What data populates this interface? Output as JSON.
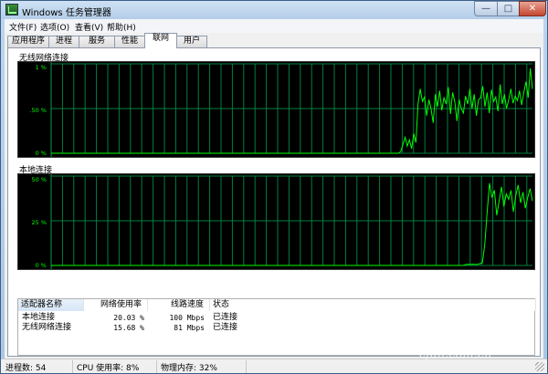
{
  "window": {
    "title": "Windows 任务管理器"
  },
  "controls": {
    "minimize": "—",
    "maximize": "□",
    "close": "✕"
  },
  "menu": [
    {
      "label": "文件(F)"
    },
    {
      "label": "选项(O)"
    },
    {
      "label": "查看(V)"
    },
    {
      "label": "帮助(H)"
    }
  ],
  "tabs": [
    {
      "label": "应用程序",
      "active": false
    },
    {
      "label": "进程",
      "active": false
    },
    {
      "label": "服务",
      "active": false
    },
    {
      "label": "性能",
      "active": false
    },
    {
      "label": "联网",
      "active": true
    },
    {
      "label": "用户",
      "active": false
    }
  ],
  "graphs": [
    {
      "name": "wireless",
      "label": "无线网络连接",
      "ticks": [
        "1 %",
        ".50 %",
        "0 %"
      ],
      "ymax": 1,
      "line_color": "#00ff00",
      "grid_color": "#008040",
      "samples": [
        0,
        0,
        0,
        0,
        0,
        0,
        0,
        0,
        0,
        0,
        0,
        0,
        0,
        0,
        0,
        0,
        0,
        0,
        0,
        0,
        0,
        0,
        0,
        0,
        0,
        0,
        0,
        0,
        0,
        0,
        0,
        0,
        0,
        0,
        0,
        0,
        0,
        0,
        0,
        0,
        0,
        0,
        0,
        0,
        0,
        0,
        0,
        0,
        0,
        0,
        0,
        0,
        0,
        0,
        0,
        0,
        0,
        0,
        0,
        0,
        0,
        0,
        0,
        0,
        0,
        0,
        0,
        0,
        0,
        0,
        0,
        0,
        0,
        0,
        0,
        0,
        0,
        0,
        0,
        0,
        0,
        0,
        0,
        0,
        0,
        0,
        0,
        0,
        0,
        0,
        0,
        0,
        0,
        0,
        0,
        0,
        0,
        0,
        0,
        0,
        0,
        0,
        0,
        0,
        0,
        0,
        0,
        0,
        0,
        0,
        0,
        0,
        0,
        0,
        0,
        0,
        0,
        0,
        0,
        0,
        0,
        0,
        0,
        0,
        0,
        0,
        0,
        0,
        0,
        0,
        0,
        0,
        0,
        0,
        0,
        0,
        0,
        0,
        0,
        0,
        0,
        0,
        0,
        0,
        0,
        0,
        0,
        0,
        0,
        0,
        0,
        0,
        0,
        0,
        0,
        0,
        0,
        0,
        0,
        0,
        0,
        0,
        0.02,
        0.1,
        0.18,
        0.08,
        0.15,
        0.05,
        0.22,
        0.12,
        0.55,
        0.72,
        0.58,
        0.63,
        0.42,
        0.6,
        0.5,
        0.34,
        0.66,
        0.52,
        0.7,
        0.48,
        0.62,
        0.55,
        0.74,
        0.44,
        0.68,
        0.58,
        0.36,
        0.6,
        0.5,
        0.45,
        0.64,
        0.55,
        0.72,
        0.5,
        0.66,
        0.42,
        0.6,
        0.62,
        0.75,
        0.52,
        0.68,
        0.45,
        0.71,
        0.58,
        0.63,
        0.47,
        0.77,
        0.55,
        0.66,
        0.5,
        0.6,
        0.72,
        0.56,
        0.64,
        0.59,
        0.7,
        0.54,
        0.68,
        0.8,
        0.62,
        0.95,
        0.72
      ]
    },
    {
      "name": "local",
      "label": "本地连接",
      "ticks": [
        "50 %",
        "25 %",
        "0 %"
      ],
      "ymax": 50,
      "line_color": "#00ff00",
      "grid_color": "#008040",
      "samples": [
        0,
        0,
        0,
        0,
        0,
        0,
        0,
        0,
        0,
        0,
        0,
        0,
        0,
        0,
        0,
        0,
        0,
        0,
        0,
        0,
        0,
        0,
        0,
        0,
        0,
        0,
        0,
        0,
        0,
        0,
        0,
        0,
        0,
        0,
        0,
        0,
        0,
        0,
        0,
        0,
        0,
        0,
        0,
        0,
        0,
        0,
        0,
        0,
        0,
        0,
        0,
        0,
        0,
        0,
        0,
        0,
        0,
        0,
        0,
        0,
        0,
        0,
        0,
        0,
        0,
        0,
        0,
        0,
        0,
        0,
        0,
        0,
        0,
        0,
        0,
        0,
        0,
        0,
        0,
        0,
        0,
        0,
        0,
        0,
        0,
        0,
        0,
        0,
        0,
        0,
        0,
        0,
        0,
        0,
        0,
        0,
        0,
        0,
        0,
        0,
        0,
        0,
        0,
        0,
        0,
        0,
        0,
        0,
        0,
        0,
        0,
        0,
        0,
        0,
        0,
        0,
        0,
        0,
        0,
        0,
        0,
        0,
        0,
        0,
        0,
        0,
        0,
        0,
        0,
        0,
        0,
        0,
        0,
        0,
        0,
        0,
        0,
        0,
        0,
        0,
        0,
        0,
        0,
        0,
        0,
        0,
        0,
        0,
        0,
        0,
        0,
        0,
        0,
        0,
        0,
        0,
        0,
        0,
        0,
        0,
        0,
        0,
        0,
        0,
        0,
        0,
        0,
        0,
        0,
        0,
        0,
        0,
        0,
        0,
        0.5,
        0.6,
        0.5,
        0.7,
        0.5,
        0.6,
        1.0,
        1.5,
        12,
        30,
        46,
        38,
        42,
        28,
        36,
        44,
        33,
        40,
        37,
        42,
        30,
        39,
        45,
        35,
        41,
        32,
        38,
        43,
        36
      ]
    }
  ],
  "table": {
    "columns": [
      "适配器名称",
      "网络使用率",
      "线路速度",
      "状态"
    ],
    "rows": [
      {
        "name": "本地连接",
        "usage": "20.03 %",
        "speed": "100 Mbps",
        "status": "已连接"
      },
      {
        "name": "无线网络连接",
        "usage": "15.68 %",
        "speed": "81 Mbps",
        "status": "已连接"
      }
    ]
  },
  "status": {
    "processes": "进程数: 54",
    "cpu": "CPU 使用率: 8%",
    "memory": "物理内存: 32%"
  },
  "watermark": "cfan.com.cn"
}
